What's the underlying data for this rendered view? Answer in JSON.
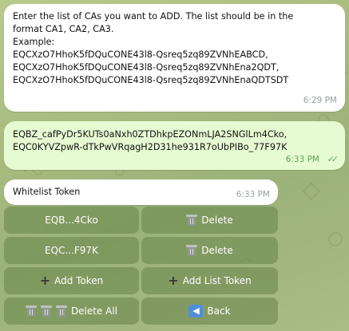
{
  "messages": {
    "instruction": {
      "lines": [
        "Enter the list of CAs you want to ADD. The list should be in the",
        "format CA1, CA2, CA3.",
        "Example:",
        "EQCXzO7HhoK5fDQuCONE43l8-Qsreq5zq89ZVNhEABCD,",
        "EQCXzO7HhoK5fDQuCONE43l8-Qsreq5zq89ZVNhEna2QDT,",
        "EQCXzO7HhoK5fDQuCONE43l8-Qsreq5zq89ZVNhEnaQDTSDT"
      ],
      "time": "6:29 PM"
    },
    "user_reply": {
      "lines": [
        "EQBZ_cafPyDr5KUTs0aNxh0ZTDhkpEZONmLJA2SNGlLm4Cko,",
        "EQC0KYVZpwR-dTkPwVRqagH2D31he931R7oUbPIBo_77F97K"
      ],
      "time": "6:33 PM",
      "status_icon": "double-check-icon"
    },
    "whitelist": {
      "text": "Whitelist Token",
      "time": "6:33 PM"
    }
  },
  "keyboard": {
    "row1_left": "EQB...4Cko",
    "row1_right": "Delete",
    "row2_left": "EQC...F97K",
    "row2_right": "Delete",
    "add_token": "Add Token",
    "add_list_token": "Add List Token",
    "delete_all": "Delete All",
    "back": "Back"
  },
  "icons": {
    "delete": "trash-icon",
    "add": "plus-icon",
    "back": "back-arrow-icon"
  },
  "colors": {
    "wallpaper": "#a7bb7e",
    "outgoing_bubble": "#e6fbd2",
    "incoming_bubble": "#ffffff",
    "keyboard_button": "#688448",
    "read_check": "#5fa45a",
    "back_icon": "#4e8fd8"
  }
}
